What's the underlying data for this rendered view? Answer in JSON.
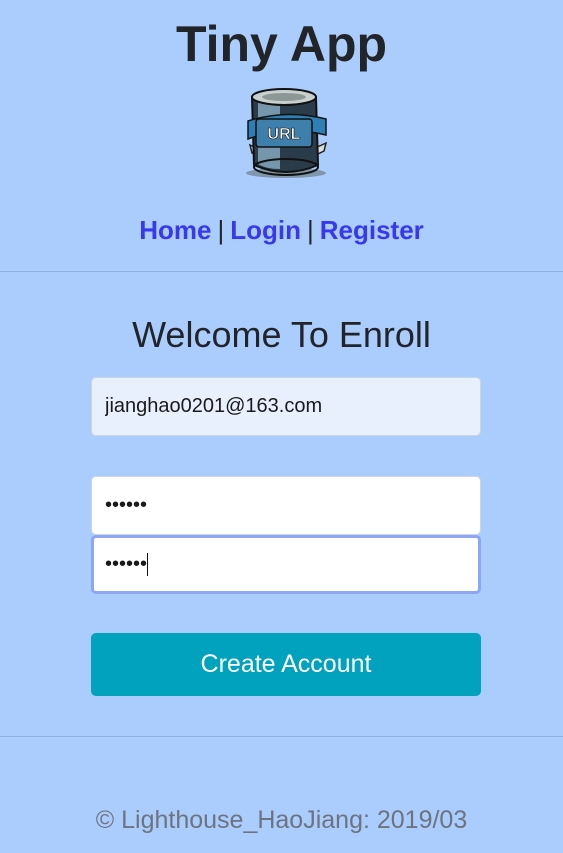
{
  "header": {
    "title": "Tiny App",
    "logo_icon": "url-barrel-icon",
    "logo_text": "URL"
  },
  "nav": {
    "items": [
      {
        "label": "Home"
      },
      {
        "label": "Login"
      },
      {
        "label": "Register"
      }
    ],
    "separator": "|"
  },
  "form": {
    "heading": "Welcome To Enroll",
    "email_value": "jianghao0201@163.com",
    "password_value": "passwd",
    "confirm_value": "passwd",
    "submit_label": "Create Account"
  },
  "footer": {
    "text": "© Lighthouse_HaoJiang: 2019/03"
  },
  "colors": {
    "background": "#abcdfd",
    "nav_link": "#3838ec",
    "button": "#00a2bd",
    "focus_border": "#8ea6f8"
  }
}
